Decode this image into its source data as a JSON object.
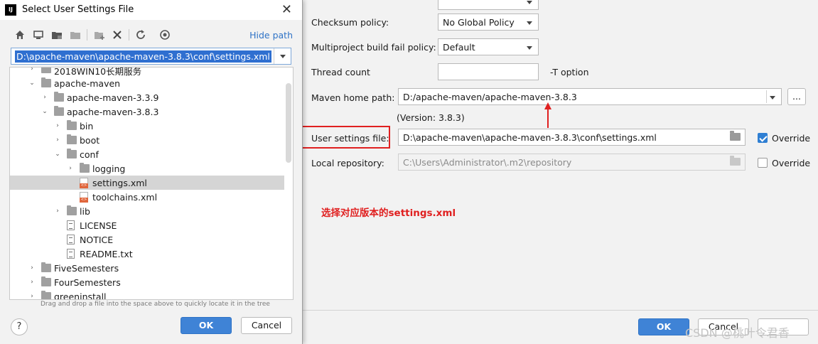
{
  "dialog": {
    "title": "Select User Settings File",
    "app_logo": "IJ",
    "close_glyph": "✕",
    "hide_path_label": "Hide path",
    "path_value": "D:\\apache-maven\\apache-maven-3.8.3\\conf\\settings.xml",
    "tree": [
      {
        "label": "2018WIN10长期服务",
        "depth": 0,
        "icon": "folder-icon",
        "chevron": "›"
      },
      {
        "label": "apache-maven",
        "depth": 0,
        "icon": "folder-icon",
        "chevron": "⌄"
      },
      {
        "label": "apache-maven-3.3.9",
        "depth": 1,
        "icon": "folder-icon",
        "chevron": "›"
      },
      {
        "label": "apache-maven-3.8.3",
        "depth": 1,
        "icon": "folder-icon",
        "chevron": "⌄"
      },
      {
        "label": "bin",
        "depth": 2,
        "icon": "folder-icon",
        "chevron": "›"
      },
      {
        "label": "boot",
        "depth": 2,
        "icon": "folder-icon",
        "chevron": "›"
      },
      {
        "label": "conf",
        "depth": 2,
        "icon": "folder-icon",
        "chevron": "⌄"
      },
      {
        "label": "logging",
        "depth": 3,
        "icon": "folder-icon",
        "chevron": "›"
      },
      {
        "label": "settings.xml",
        "depth": 3,
        "icon": "xml-file-icon",
        "chevron": "",
        "selected": true
      },
      {
        "label": "toolchains.xml",
        "depth": 3,
        "icon": "xml-file-icon",
        "chevron": ""
      },
      {
        "label": "lib",
        "depth": 2,
        "icon": "folder-icon",
        "chevron": "›"
      },
      {
        "label": "LICENSE",
        "depth": 2,
        "icon": "text-file-icon",
        "chevron": ""
      },
      {
        "label": "NOTICE",
        "depth": 2,
        "icon": "text-file-icon",
        "chevron": ""
      },
      {
        "label": "README.txt",
        "depth": 2,
        "icon": "text-file-icon",
        "chevron": ""
      },
      {
        "label": "FiveSemesters",
        "depth": 0,
        "icon": "folder-icon",
        "chevron": "›"
      },
      {
        "label": "FourSemesters",
        "depth": 0,
        "icon": "folder-icon",
        "chevron": "›"
      },
      {
        "label": "greeninstall",
        "depth": 0,
        "icon": "folder-icon",
        "chevron": "›"
      }
    ],
    "hint": "Drag and drop a file into the space above to quickly locate it in the tree",
    "ok_label": "OK",
    "cancel_label": "Cancel",
    "help_glyph": "?"
  },
  "settings": {
    "checksum_label": "Checksum policy:",
    "checksum_value": "No Global Policy",
    "multiproject_label": "Multiproject build fail policy:",
    "multiproject_value": "Default",
    "thread_label": "Thread count",
    "thread_value": "",
    "thread_suffix": "-T option",
    "maven_home_label": "Maven home path:",
    "maven_home_value": "D:/apache-maven/apache-maven-3.8.3",
    "browse_label": "...",
    "version_text": "(Version: 3.8.3)",
    "user_settings_label": "User settings file:",
    "user_settings_value": "D:\\apache-maven\\apache-maven-3.8.3\\conf\\settings.xml",
    "user_override_label": "Override",
    "local_repo_label": "Local repository:",
    "local_repo_value": "C:\\Users\\Administrator\\.m2\\repository",
    "local_override_label": "Override",
    "ok_label": "OK",
    "cancel_label": "Cancel"
  },
  "annotation": {
    "text": "选择对应版本的settings.xml",
    "color": "#e02020"
  },
  "watermark": "CSDN @桃叶令君香"
}
